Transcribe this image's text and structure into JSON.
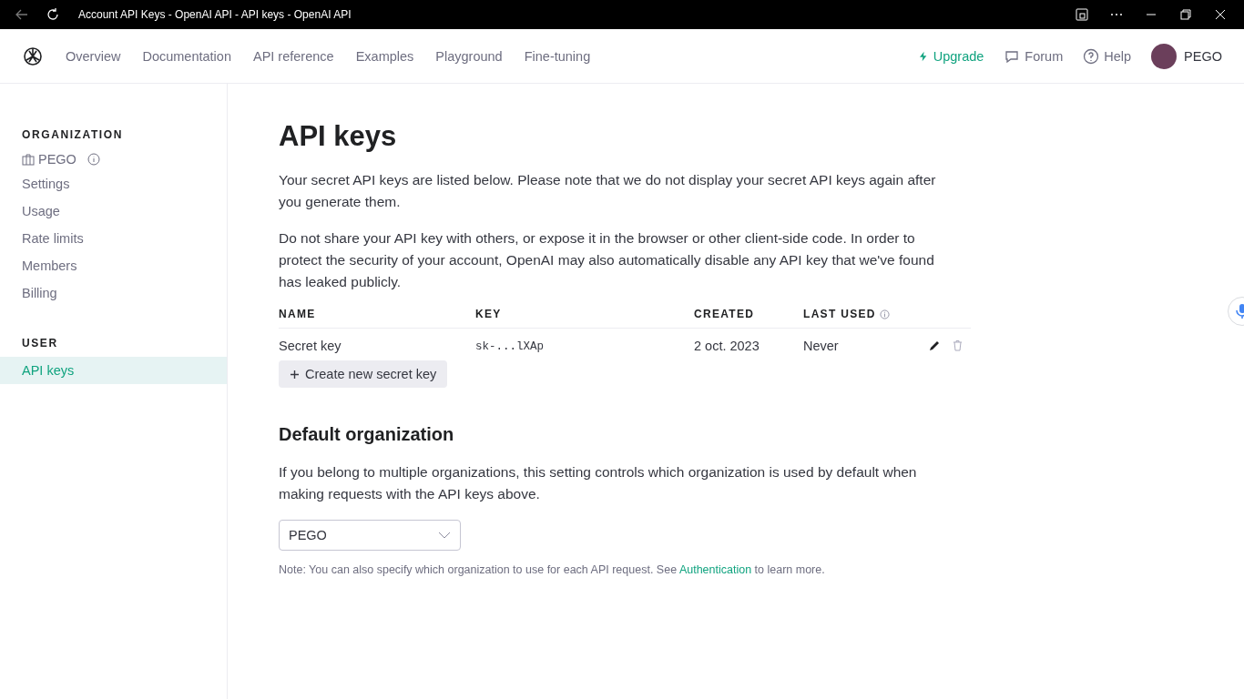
{
  "window": {
    "title": "Account API Keys - OpenAI API - API keys - OpenAI API"
  },
  "nav": {
    "items": [
      "Overview",
      "Documentation",
      "API reference",
      "Examples",
      "Playground",
      "Fine-tuning"
    ],
    "upgrade": "Upgrade",
    "forum": "Forum",
    "help": "Help",
    "user": "PEGO"
  },
  "sidebar": {
    "sections": [
      {
        "heading": "ORGANIZATION",
        "org": "PEGO",
        "items": [
          {
            "label": "Settings",
            "selected": false
          },
          {
            "label": "Usage",
            "selected": false
          },
          {
            "label": "Rate limits",
            "selected": false
          },
          {
            "label": "Members",
            "selected": false
          },
          {
            "label": "Billing",
            "selected": false
          }
        ]
      },
      {
        "heading": "USER",
        "items": [
          {
            "label": "API keys",
            "selected": true
          }
        ]
      }
    ]
  },
  "page": {
    "title": "API keys",
    "paragraphs": [
      "Your secret API keys are listed below. Please note that we do not display your secret API keys again after you generate them.",
      "Do not share your API key with others, or expose it in the browser or other client-side code. In order to protect the security of your account, OpenAI may also automatically disable any API key that we've found has leaked publicly."
    ],
    "table": {
      "columns": [
        "NAME",
        "KEY",
        "CREATED",
        "LAST USED"
      ],
      "rows": [
        {
          "name": "Secret key",
          "key": "sk-...lXAp",
          "created": "2 oct. 2023",
          "last_used": "Never"
        }
      ]
    },
    "create_button": "Create new secret key",
    "default_org": {
      "heading": "Default organization",
      "text": "If you belong to multiple organizations, this setting controls which organization is used by default when making requests with the API keys above.",
      "select_value": "PEGO",
      "note": {
        "before": "Note: You can also specify which organization to use for each API request. See ",
        "link": "Authentication",
        "after": " to learn more."
      }
    }
  }
}
